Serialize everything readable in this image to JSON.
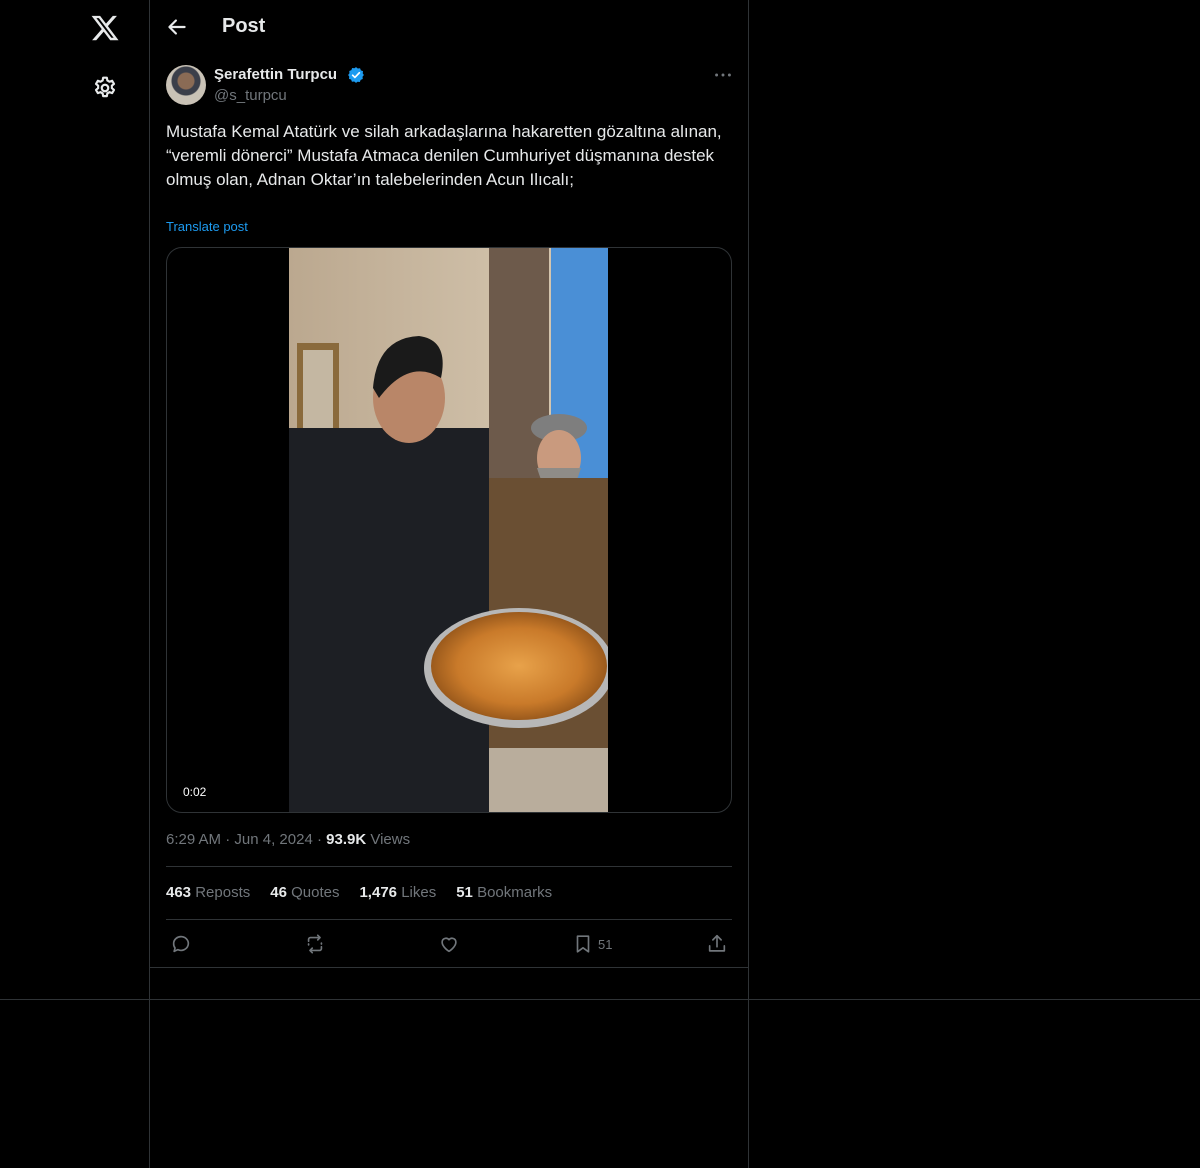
{
  "sidebar": {
    "logo_icon": "x-logo-icon",
    "settings_icon": "gear-icon"
  },
  "header": {
    "back_icon": "back-arrow-icon",
    "title": "Post"
  },
  "post": {
    "author_name": "Şerafettin Turpcu",
    "verified_icon": "verified-badge-icon",
    "handle": "@s_turpcu",
    "more_icon": "more-icon",
    "text": "Mustafa Kemal Atatürk ve silah arkadaşlarına hakaretten gözaltına alınan,\n“veremli dönerci” Mustafa Atmaca denilen Cumhuriyet düşmanına destek olmuş olan, Adnan Oktar’ın talebelerinden Acun Ilıcalı;",
    "translate_label": "Translate post",
    "video_duration": "0:02",
    "time": "6:29 AM",
    "date": "Jun 4, 2024",
    "views_count": "93.9K",
    "views_label": "Views",
    "stats": {
      "reposts_count": "463",
      "reposts_label": "Reposts",
      "quotes_count": "46",
      "quotes_label": "Quotes",
      "likes_count": "1,476",
      "likes_label": "Likes",
      "bookmarks_count": "51",
      "bookmarks_label": "Bookmarks"
    },
    "actions": {
      "reply_icon": "reply-icon",
      "repost_icon": "repost-icon",
      "like_icon": "like-icon",
      "bookmark_icon": "bookmark-icon",
      "bookmark_count": "51",
      "share_icon": "share-icon"
    }
  },
  "colors": {
    "background": "#000000",
    "text_primary": "#e7e9ea",
    "text_secondary": "#71767b",
    "accent": "#1d9bf0",
    "border": "#2f3336"
  }
}
